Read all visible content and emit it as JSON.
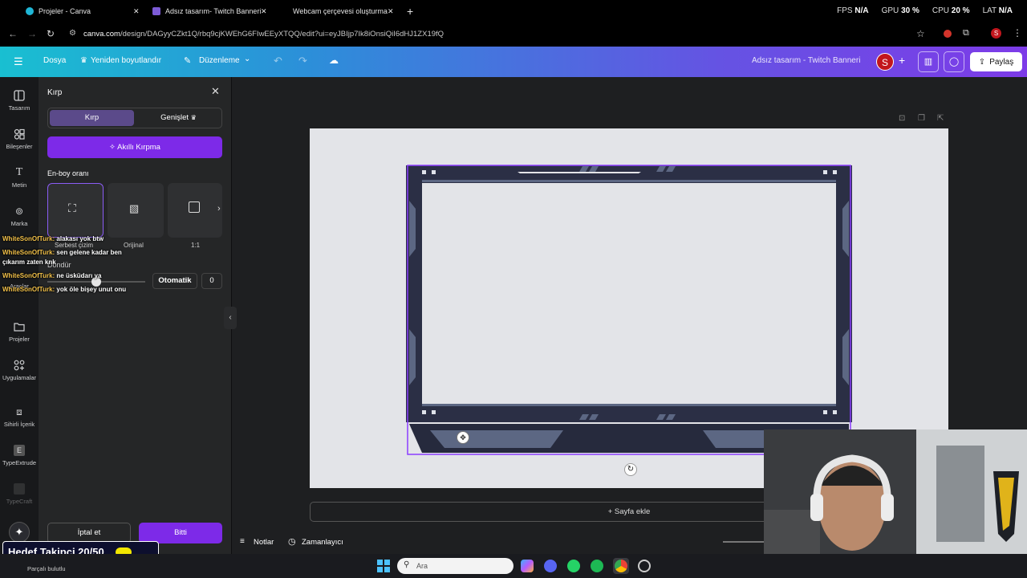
{
  "browser": {
    "tabs": [
      {
        "title": "Projeler - Canva"
      },
      {
        "title": "Adsız tasarım- Twitch Banneri"
      },
      {
        "title": "Webcam çerçevesi oluşturma"
      }
    ],
    "perf": {
      "fps_label": "FPS",
      "fps_val": "N/A",
      "gpu_label": "GPU",
      "gpu_val": "30 %",
      "cpu_label": "CPU",
      "cpu_val": "20 %",
      "lat_label": "LAT",
      "lat_val": "N/A"
    },
    "url_host": "canva.com",
    "url_path": "/design/DAGyyCZkt1Q/rbq9cjKWEhG6FIwEEyXTQQ/edit?ui=eyJBIjp7Ik8iOnsiQiI6dHJ1ZX19fQ"
  },
  "header": {
    "file": "Dosya",
    "resize": "Yeniden boyutlandır",
    "edit": "Düzenleme",
    "title": "Adsız tasarım - Twitch Banneri",
    "avatar": "S",
    "share": "Paylaş"
  },
  "rail": {
    "items": [
      "Tasarım",
      "Bileşenler",
      "Metin",
      "Marka",
      "Araçlar",
      "Projeler",
      "Uygulamalar",
      "Sihirli İçerik",
      "TypeExtrude",
      "TypeCraft"
    ]
  },
  "panel": {
    "title": "Kırp",
    "tabs": [
      "Kırp",
      "Genişlet"
    ],
    "smart_crop": "Akıllı Kırpma",
    "aspect_label": "En-boy oranı",
    "aspect_options": [
      "Serbest çizim",
      "Orijinal",
      "1:1"
    ],
    "rotate_label": "Döndür",
    "auto_button": "Otomatik",
    "rotate_value": "0",
    "cancel": "İptal et",
    "done": "Bitti"
  },
  "canvas": {
    "add_page": "+ Sayfa ekle",
    "notes": "Notlar",
    "timer": "Zamanlayıcı"
  },
  "chat": [
    {
      "user": "WhiteSonOfTurk:",
      "msg": "alakası yok btw"
    },
    {
      "user": "WhiteSonOfTurk:",
      "msg": "sen gelene kadar ben"
    },
    {
      "user": "",
      "msg": "çıkarım zaten knk"
    },
    {
      "user": "WhiteSonOfTurk:",
      "msg": "ne üsküdarı ya"
    },
    {
      "user": "WhiteSonOfTurk:",
      "msg": "yok öle bişey unut onu"
    }
  ],
  "overlay": {
    "goal": "Hedef Takipçi 20/50",
    "taskbar_search": "Ara",
    "weather": "Parçalı bulutlu"
  },
  "colors": {
    "accent_purple": "#7d2ae8",
    "frame_dark": "#2b2f45",
    "frame_light": "#5c6783"
  }
}
